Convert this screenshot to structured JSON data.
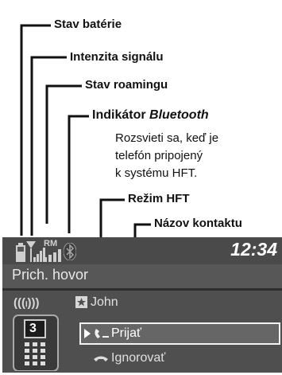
{
  "annotations": {
    "battery": "Stav batérie",
    "signal": "Intenzita signálu",
    "roaming": "Stav roamingu",
    "bluetooth_prefix": "Indikátor ",
    "bluetooth_word": "Bluetooth",
    "bluetooth_desc": [
      "Rozsvieti sa, keď je",
      "telefón pripojený",
      "k systému HFT."
    ],
    "hft_mode": "Režim HFT",
    "contact_name": "Názov kontaktu"
  },
  "screen": {
    "clock": "12:34",
    "mode": "Prich. hovor",
    "roaming_badge": "RM",
    "ring_indicator": "(((ₗ)))",
    "contact": "John",
    "phone_slot": "3",
    "options": {
      "accept": "Prijať",
      "ignore": "Ignorovať"
    }
  },
  "icons": {
    "battery": "battery-icon",
    "signal": "signal-strength-icon",
    "roaming": "roaming-icon",
    "bluetooth": "bluetooth-icon",
    "ringing": "ringing-icon",
    "contact": "contact-star-icon",
    "phone": "phone-keypad-icon",
    "accept": "accept-call-icon",
    "ignore": "ignore-call-icon"
  }
}
